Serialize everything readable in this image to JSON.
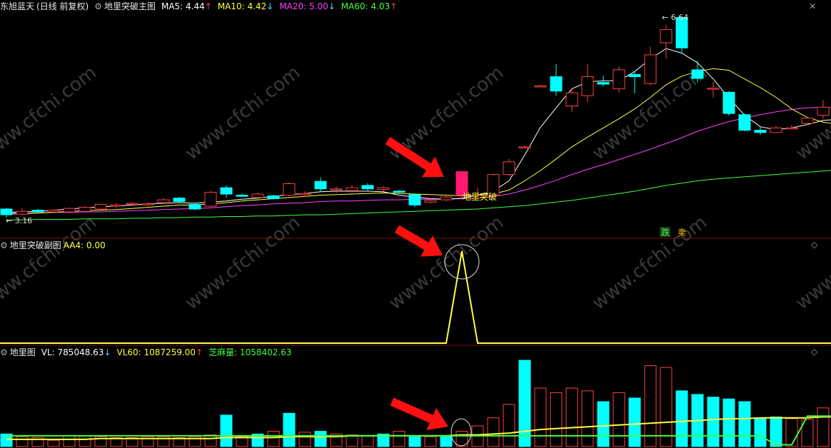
{
  "stock": {
    "name": "东旭蓝天",
    "period": "(日线 前复权)"
  },
  "main": {
    "indicator": "地里突破主图",
    "ma_labels": [
      {
        "text": "MA5: 4.44",
        "arrow": "↑",
        "color": "#ffffff",
        "arrow_color": "#ff4040"
      },
      {
        "text": "MA10: 4.42",
        "arrow": "↓",
        "color": "#ffff40",
        "arrow_color": "#40e0ff"
      },
      {
        "text": "MA20: 5.00",
        "arrow": "↓",
        "color": "#ff40ff",
        "arrow_color": "#40e0ff"
      },
      {
        "text": "MA60: 4.03",
        "arrow": "↑",
        "color": "#40ff40",
        "arrow_color": "#ff4040"
      }
    ],
    "high_label": "6.64",
    "low_label": "3.16",
    "signal_label": "地里突破",
    "sell_label": "跌",
    "sell_label2": "卖"
  },
  "sub1": {
    "indicator": "地里突破副图",
    "value_text": "AA4: 0.00"
  },
  "sub2": {
    "indicator": "地里图",
    "labels": [
      {
        "text": "VL: 785048.63",
        "arrow": "↓",
        "color": "#ffffff",
        "arrow_color": "#40e0ff"
      },
      {
        "text": "VL60: 1087259.00",
        "arrow": "↑",
        "color": "#ffff40",
        "arrow_color": "#ff4040"
      },
      {
        "text": "芝麻量: 1058402.63",
        "arrow": "",
        "color": "#40ff40",
        "arrow_color": "#40ff40"
      }
    ]
  },
  "watermark": "www.cfchi.com",
  "tools": {
    "close": "✕",
    "diamond": "◇"
  },
  "colors": {
    "up": "#ff4040",
    "down": "#00ffff",
    "signal": "#ff1a6e",
    "ma5": "#ffffff",
    "ma10": "#ffff40",
    "ma20": "#ff40ff",
    "ma60": "#40ff40",
    "vl60": "#ffff40",
    "zhima": "#40ff40",
    "sub_line": "#ffff40"
  },
  "chart_data": {
    "type": "candlestick",
    "candles": [
      {
        "o": 3.31,
        "c": 3.21,
        "h": 3.33,
        "l": 3.16
      },
      {
        "o": 3.22,
        "c": 3.27,
        "h": 3.33,
        "l": 3.2
      },
      {
        "o": 3.29,
        "c": 3.26,
        "h": 3.31,
        "l": 3.24
      },
      {
        "o": 3.26,
        "c": 3.29,
        "h": 3.3,
        "l": 3.24
      },
      {
        "o": 3.26,
        "c": 3.32,
        "h": 3.34,
        "l": 3.24
      },
      {
        "o": 3.27,
        "c": 3.34,
        "h": 3.36,
        "l": 3.25
      },
      {
        "o": 3.31,
        "c": 3.39,
        "h": 3.4,
        "l": 3.29
      },
      {
        "o": 3.36,
        "c": 3.38,
        "h": 3.41,
        "l": 3.33
      },
      {
        "o": 3.39,
        "c": 3.41,
        "h": 3.43,
        "l": 3.37
      },
      {
        "o": 3.4,
        "c": 3.4,
        "h": 3.43,
        "l": 3.37
      },
      {
        "o": 3.42,
        "c": 3.47,
        "h": 3.5,
        "l": 3.4
      },
      {
        "o": 3.5,
        "c": 3.44,
        "h": 3.52,
        "l": 3.42
      },
      {
        "o": 3.39,
        "c": 3.31,
        "h": 3.41,
        "l": 3.29
      },
      {
        "o": 3.36,
        "c": 3.6,
        "h": 3.63,
        "l": 3.34
      },
      {
        "o": 3.68,
        "c": 3.57,
        "h": 3.72,
        "l": 3.51
      },
      {
        "o": 3.55,
        "c": 3.54,
        "h": 3.58,
        "l": 3.52
      },
      {
        "o": 3.51,
        "c": 3.57,
        "h": 3.6,
        "l": 3.49
      },
      {
        "o": 3.54,
        "c": 3.49,
        "h": 3.56,
        "l": 3.47
      },
      {
        "o": 3.55,
        "c": 3.75,
        "h": 3.78,
        "l": 3.53
      },
      {
        "o": 3.57,
        "c": 3.58,
        "h": 3.62,
        "l": 3.55
      },
      {
        "o": 3.79,
        "c": 3.66,
        "h": 3.86,
        "l": 3.61
      },
      {
        "o": 3.65,
        "c": 3.66,
        "h": 3.7,
        "l": 3.59
      },
      {
        "o": 3.63,
        "c": 3.68,
        "h": 3.73,
        "l": 3.59
      },
      {
        "o": 3.72,
        "c": 3.66,
        "h": 3.76,
        "l": 3.63
      },
      {
        "o": 3.65,
        "c": 3.68,
        "h": 3.71,
        "l": 3.62
      },
      {
        "o": 3.62,
        "c": 3.61,
        "h": 3.64,
        "l": 3.58
      },
      {
        "o": 3.56,
        "c": 3.38,
        "h": 3.58,
        "l": 3.34
      },
      {
        "o": 3.43,
        "c": 3.46,
        "h": 3.5,
        "l": 3.41
      },
      {
        "o": 3.47,
        "c": 3.52,
        "h": 3.55,
        "l": 3.45
      },
      {
        "o": 3.52,
        "c": 3.48,
        "h": 3.55,
        "l": 3.46
      },
      {
        "o": 3.5,
        "c": 3.55,
        "h": 3.68,
        "l": 3.48
      },
      {
        "o": 3.55,
        "c": 3.91,
        "h": 3.93,
        "l": 3.55
      },
      {
        "o": 3.91,
        "c": 4.13,
        "h": 4.18,
        "l": 3.88
      },
      {
        "o": 4.39,
        "c": 4.39,
        "h": 4.41,
        "l": 4.37
      },
      {
        "o": 5.45,
        "c": 5.45,
        "h": 5.47,
        "l": 5.43
      },
      {
        "o": 5.61,
        "c": 5.36,
        "h": 5.83,
        "l": 5.28
      },
      {
        "o": 5.1,
        "c": 5.33,
        "h": 5.4,
        "l": 5.0
      },
      {
        "o": 5.28,
        "c": 5.61,
        "h": 5.83,
        "l": 5.17
      },
      {
        "o": 5.51,
        "c": 5.48,
        "h": 5.63,
        "l": 5.44
      },
      {
        "o": 5.4,
        "c": 5.73,
        "h": 5.79,
        "l": 5.33
      },
      {
        "o": 5.65,
        "c": 5.61,
        "h": 5.69,
        "l": 5.32
      },
      {
        "o": 5.49,
        "c": 5.99,
        "h": 6.13,
        "l": 5.46
      },
      {
        "o": 6.2,
        "c": 6.43,
        "h": 6.51,
        "l": 5.93
      },
      {
        "o": 6.64,
        "c": 6.11,
        "h": 6.64,
        "l": 6.02
      },
      {
        "o": 5.73,
        "c": 5.58,
        "h": 5.89,
        "l": 5.51
      },
      {
        "o": 5.41,
        "c": 5.41,
        "h": 5.52,
        "l": 5.25
      },
      {
        "o": 5.34,
        "c": 4.97,
        "h": 5.36,
        "l": 4.93
      },
      {
        "o": 4.95,
        "c": 4.68,
        "h": 4.97,
        "l": 4.66
      },
      {
        "o": 4.68,
        "c": 4.64,
        "h": 4.74,
        "l": 4.6
      },
      {
        "o": 4.64,
        "c": 4.72,
        "h": 4.76,
        "l": 4.63
      },
      {
        "o": 4.71,
        "c": 4.72,
        "h": 4.77,
        "l": 4.7
      },
      {
        "o": 4.8,
        "c": 4.89,
        "h": 4.9,
        "l": 4.77
      },
      {
        "o": 4.94,
        "c": 5.08,
        "h": 5.2,
        "l": 4.88
      },
      {
        "o": 5.09,
        "c": 4.97,
        "h": 5.11,
        "l": 4.93
      },
      {
        "o": 4.96,
        "c": 4.89,
        "h": 4.99,
        "l": 4.86
      }
    ],
    "ma5": [
      3.25,
      3.26,
      3.27,
      3.29,
      3.31,
      3.33,
      3.35,
      3.36,
      3.38,
      3.4,
      3.41,
      3.42,
      3.41,
      3.43,
      3.45,
      3.48,
      3.5,
      3.53,
      3.56,
      3.58,
      3.61,
      3.62,
      3.62,
      3.62,
      3.61,
      3.55,
      3.52,
      3.49,
      3.48,
      3.5,
      3.55,
      3.62,
      3.8,
      4.25,
      4.73,
      5.07,
      5.4,
      5.52,
      5.54,
      5.54,
      5.7,
      5.92,
      6.1,
      6.02,
      5.85,
      5.57,
      5.24,
      4.94,
      4.74,
      4.69,
      4.72,
      4.78,
      4.85,
      4.87,
      4.89
    ],
    "ma10": [
      3.22,
      3.23,
      3.24,
      3.25,
      3.27,
      3.28,
      3.29,
      3.3,
      3.32,
      3.34,
      3.36,
      3.38,
      3.38,
      3.4,
      3.42,
      3.45,
      3.47,
      3.49,
      3.51,
      3.53,
      3.55,
      3.56,
      3.57,
      3.58,
      3.59,
      3.58,
      3.57,
      3.56,
      3.55,
      3.54,
      3.55,
      3.57,
      3.64,
      3.8,
      3.98,
      4.18,
      4.39,
      4.56,
      4.72,
      4.88,
      5.05,
      5.25,
      5.47,
      5.62,
      5.7,
      5.75,
      5.72,
      5.57,
      5.42,
      5.25,
      5.05,
      4.9,
      4.82,
      4.78,
      4.76
    ],
    "ma20": [
      3.24,
      3.24,
      3.24,
      3.25,
      3.25,
      3.26,
      3.26,
      3.27,
      3.28,
      3.29,
      3.3,
      3.31,
      3.32,
      3.33,
      3.35,
      3.37,
      3.38,
      3.4,
      3.41,
      3.42,
      3.44,
      3.45,
      3.45,
      3.46,
      3.47,
      3.47,
      3.48,
      3.48,
      3.48,
      3.49,
      3.5,
      3.53,
      3.57,
      3.64,
      3.72,
      3.81,
      3.91,
      4.0,
      4.08,
      4.17,
      4.26,
      4.35,
      4.45,
      4.55,
      4.66,
      4.75,
      4.83,
      4.89,
      4.95,
      5.0,
      5.04,
      5.07,
      5.08,
      5.06,
      5.03
    ],
    "ma60": [
      3.12,
      3.12,
      3.13,
      3.13,
      3.13,
      3.14,
      3.14,
      3.14,
      3.15,
      3.15,
      3.16,
      3.16,
      3.17,
      3.17,
      3.18,
      3.18,
      3.19,
      3.19,
      3.2,
      3.21,
      3.21,
      3.22,
      3.23,
      3.24,
      3.25,
      3.26,
      3.27,
      3.28,
      3.29,
      3.3,
      3.31,
      3.33,
      3.35,
      3.37,
      3.4,
      3.43,
      3.46,
      3.5,
      3.54,
      3.58,
      3.62,
      3.67,
      3.72,
      3.76,
      3.8,
      3.83,
      3.85,
      3.87,
      3.89,
      3.91,
      3.93,
      3.95,
      3.97,
      3.99,
      4.03
    ],
    "sub_aa4": [
      0,
      0,
      0,
      0,
      0,
      0,
      0,
      0,
      0,
      0,
      0,
      0,
      0,
      0,
      0,
      0,
      0,
      0,
      0,
      0,
      0,
      0,
      0,
      0,
      0,
      0,
      0,
      0,
      0,
      1,
      0,
      0,
      0,
      0,
      0,
      0,
      0,
      0,
      0,
      0,
      0,
      0,
      0,
      0,
      0,
      0,
      0,
      0,
      0,
      0,
      0,
      0,
      0,
      0,
      0
    ],
    "volume": [
      14,
      11,
      10,
      7,
      12,
      12,
      11,
      10,
      10,
      11,
      11,
      10,
      11,
      13,
      35,
      11,
      14,
      17,
      37,
      16,
      17,
      14,
      13,
      12,
      14,
      17,
      12,
      11,
      12,
      17,
      23,
      32,
      47,
      96,
      65,
      60,
      65,
      62,
      50,
      60,
      54,
      90,
      88,
      62,
      58,
      55,
      53,
      50,
      32,
      33,
      31,
      30,
      43,
      32,
      22
    ],
    "volume_dir": [
      0,
      1,
      1,
      1,
      1,
      1,
      1,
      1,
      1,
      1,
      1,
      1,
      1,
      1,
      0,
      1,
      0,
      1,
      0,
      1,
      0,
      1,
      1,
      1,
      0,
      1,
      0,
      1,
      0,
      1,
      1,
      1,
      1,
      0,
      1,
      1,
      1,
      1,
      0,
      1,
      0,
      1,
      1,
      0,
      0,
      0,
      0,
      0,
      0,
      0,
      1,
      1,
      1,
      0,
      0
    ],
    "vl60": [
      8,
      8,
      8,
      8,
      8,
      8,
      9,
      9,
      9,
      9,
      9,
      9,
      9,
      9,
      10,
      10,
      10,
      10,
      11,
      11,
      11,
      11,
      12,
      12,
      12,
      12,
      12,
      12,
      12,
      13,
      13,
      14,
      15,
      17,
      19,
      20,
      21,
      22,
      23,
      24,
      25,
      26,
      27,
      28,
      29,
      30,
      31,
      31,
      32,
      32,
      32,
      32,
      33,
      33,
      33
    ],
    "zhima": [
      12,
      12,
      12,
      12,
      12,
      12,
      12,
      12,
      12,
      12,
      12,
      12,
      12,
      12,
      12,
      12,
      12,
      12,
      12,
      12,
      12,
      12,
      12,
      12,
      12,
      12,
      12,
      12,
      12,
      12,
      12,
      12,
      12,
      12,
      12,
      12,
      12,
      12,
      12,
      12,
      12,
      12,
      12,
      12,
      12,
      12,
      12,
      12,
      12,
      2,
      2,
      34,
      34,
      34,
      34
    ],
    "signal_index": 29,
    "signal_marker_index": 28,
    "vol_circle_index": 29,
    "price_range": [
      3.0,
      6.72
    ],
    "sub_range": [
      0,
      1
    ],
    "volume_range": [
      0,
      100
    ]
  }
}
